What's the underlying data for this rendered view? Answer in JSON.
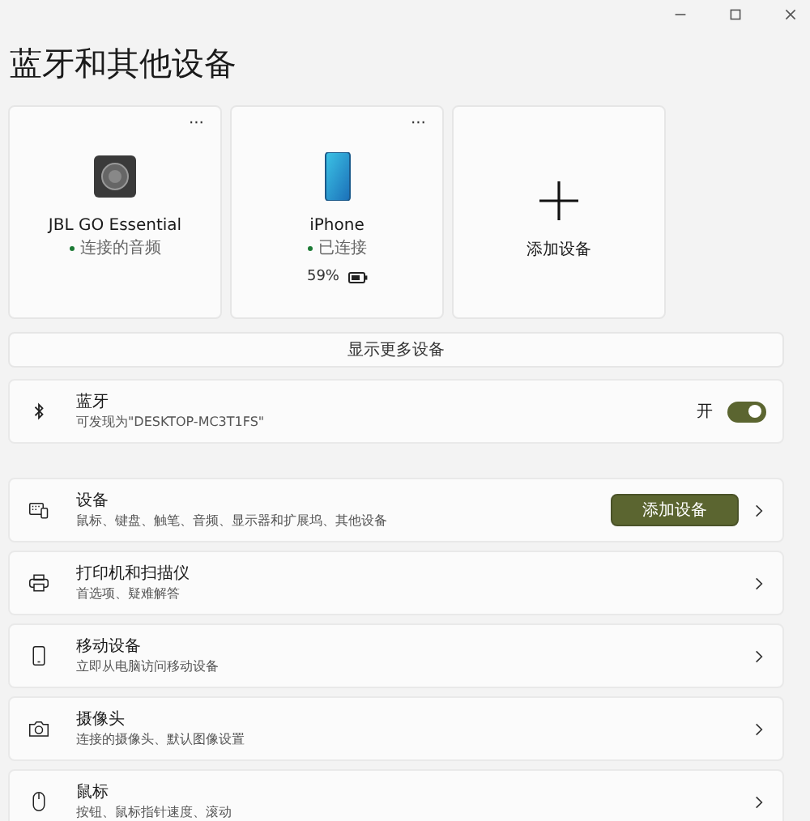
{
  "title": "蓝牙和其他设备",
  "devices": [
    {
      "kind": "speaker",
      "name": "JBL GO Essential",
      "status": "连接的音频",
      "more": "···"
    },
    {
      "kind": "phone",
      "name": "iPhone",
      "status": "已连接",
      "more": "···",
      "battery": "59%"
    },
    {
      "kind": "add",
      "name": "添加设备"
    }
  ],
  "show_more": "显示更多设备",
  "bluetooth": {
    "title": "蓝牙",
    "subtitle": "可发现为\"DESKTOP-MC3T1FS\"",
    "state_label": "开",
    "on": true
  },
  "categories": [
    {
      "title": "设备",
      "subtitle": "鼠标、键盘、触笔、音频、显示器和扩展坞、其他设备",
      "button": "添加设备"
    },
    {
      "title": "打印机和扫描仪",
      "subtitle": "首选项、疑难解答"
    },
    {
      "title": "移动设备",
      "subtitle": "立即从电脑访问移动设备"
    },
    {
      "title": "摄像头",
      "subtitle": "连接的摄像头、默认图像设置"
    },
    {
      "title": "鼠标",
      "subtitle": "按钮、鼠标指针速度、滚动"
    }
  ]
}
